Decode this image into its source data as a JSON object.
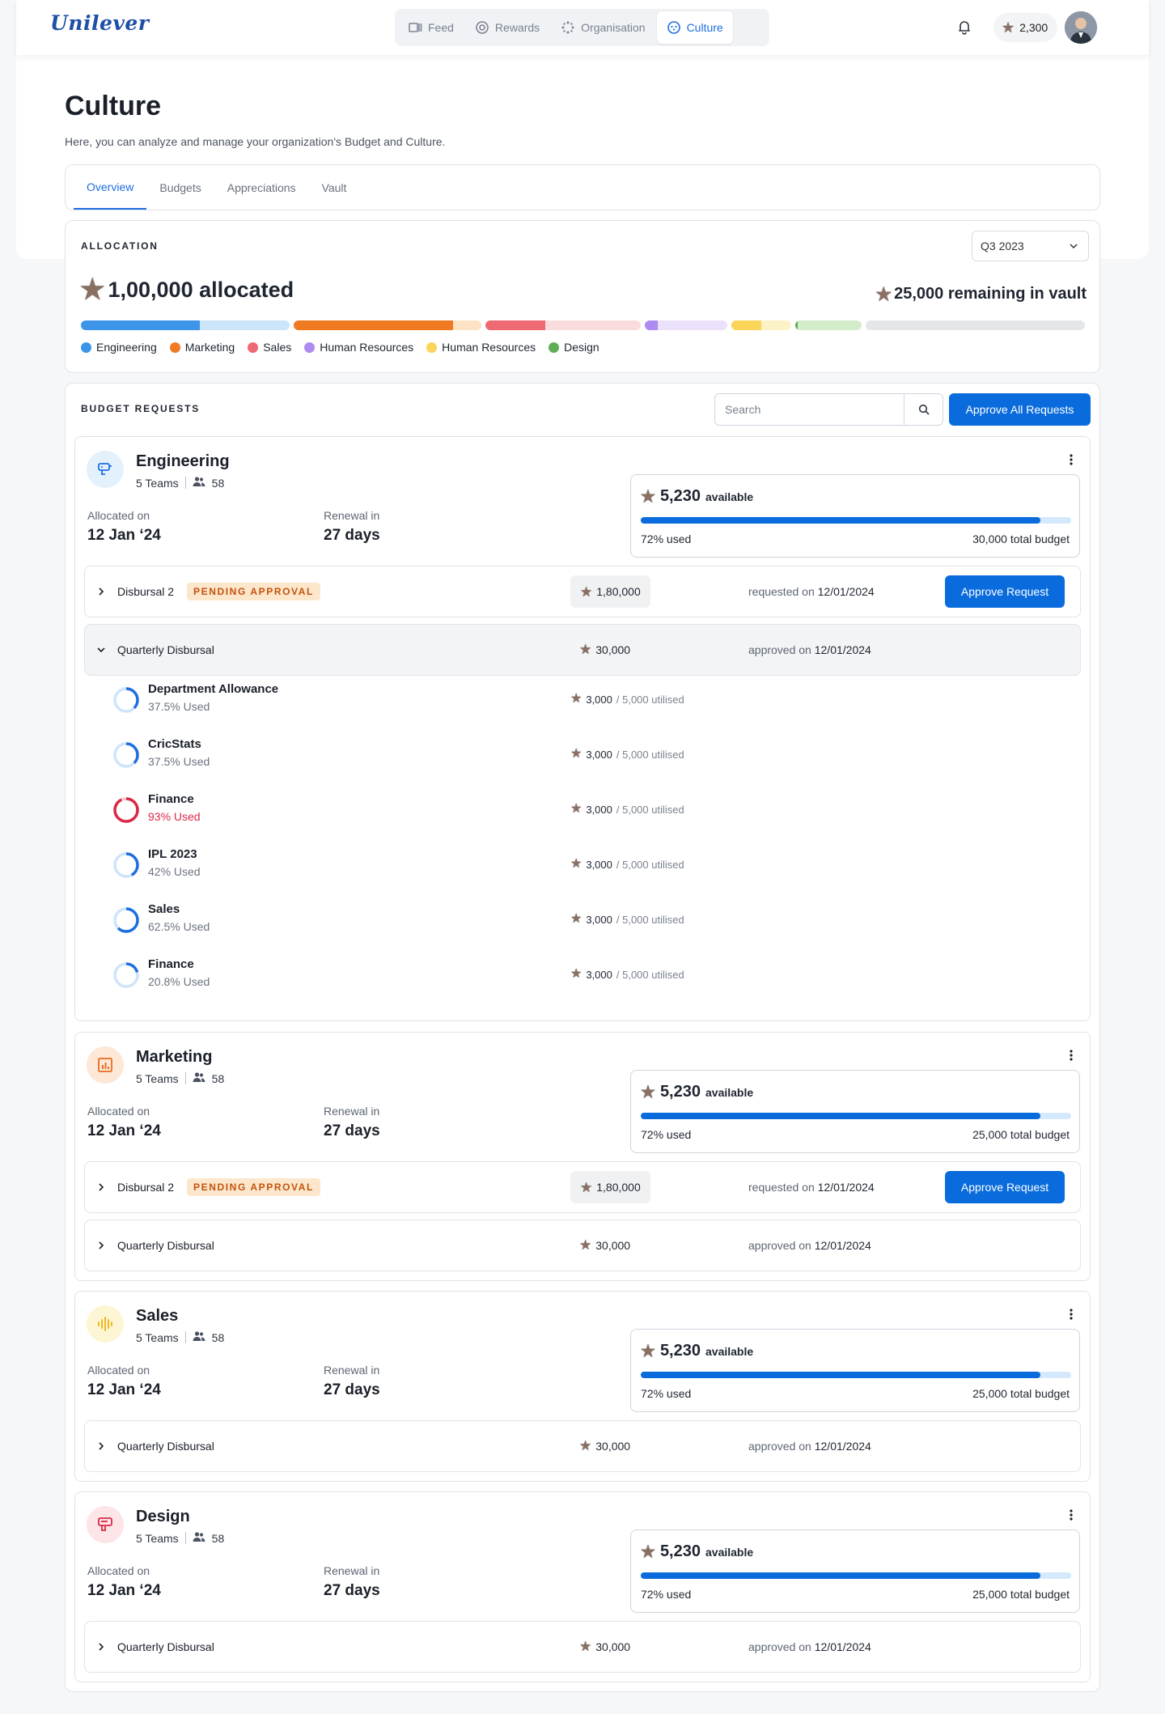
{
  "brand": {
    "logo": "Unilever"
  },
  "nav": {
    "items": [
      {
        "label": "Feed",
        "icon": "feed-icon"
      },
      {
        "label": "Rewards",
        "icon": "rewards-icon"
      },
      {
        "label": "Organisation",
        "icon": "organisation-icon"
      },
      {
        "label": "Culture",
        "icon": "culture-icon",
        "active": true
      }
    ]
  },
  "header": {
    "points": "2,300"
  },
  "page": {
    "title": "Culture",
    "subtitle": "Here, you can analyze and manage your organization's Budget and Culture."
  },
  "tabs": [
    {
      "label": "Overview",
      "active": true
    },
    {
      "label": "Budgets"
    },
    {
      "label": "Appreciations"
    },
    {
      "label": "Vault"
    }
  ],
  "allocation": {
    "label": "ALLOCATION",
    "quarter": "Q3 2023",
    "allocated": "1,00,000 allocated",
    "vault": "25,000 remaining in vault",
    "legend": [
      {
        "label": "Engineering",
        "color": "#3d95ea"
      },
      {
        "label": "Marketing",
        "color": "#ef7a22"
      },
      {
        "label": "Sales",
        "color": "#ee6a72"
      },
      {
        "label": "Human Resources",
        "color": "#ad8bf0"
      },
      {
        "label": "Human Resources",
        "color": "#fad55a"
      },
      {
        "label": "Design",
        "color": "#5fae56"
      }
    ]
  },
  "requests": {
    "label": "BUDGET REQUESTS",
    "search_placeholder": "Search",
    "approve_all": "Approve All Requests",
    "labels": {
      "allocated_on": "Allocated on",
      "renewal_in": "Renewal in",
      "available": "available",
      "used_suffix": "used",
      "total_suffix": "total budget",
      "requested_on": "requested on",
      "approved_on": "approved on",
      "approve_request": "Approve Request",
      "pending": "PENDING APPROVAL",
      "used_word": "Used",
      "utilised": "utilised"
    },
    "departments": [
      {
        "name": "Engineering",
        "teams": "5 Teams",
        "members": "58",
        "allocated_on": "12 Jan ‘24",
        "renewal": "27 days",
        "available": "5,230",
        "used_pct": "72%",
        "total": "30,000",
        "used_frac": 0.928,
        "rows": [
          {
            "name": "Disbursal 2",
            "pending": true,
            "amount": "1,80,000",
            "date_label": "requested on",
            "date": "12/01/2024"
          },
          {
            "name": "Quarterly Disbursal",
            "pending": false,
            "expanded": true,
            "amount": "30,000",
            "date_label": "approved on",
            "date": "12/01/2024",
            "items": [
              {
                "name": "Department Allowance",
                "pct": "37.5%",
                "frac": 0.375,
                "amount": "3,000",
                "of": "/ 5,000 utilised"
              },
              {
                "name": "CricStats",
                "pct": "37.5%",
                "frac": 0.375,
                "amount": "3,000",
                "of": "/ 5,000 utilised"
              },
              {
                "name": "Finance",
                "pct": "93%",
                "frac": 0.93,
                "amount": "3,000",
                "of": "/ 5,000 utilised",
                "red": true
              },
              {
                "name": "IPL 2023",
                "pct": "42%",
                "frac": 0.42,
                "amount": "3,000",
                "of": "/ 5,000 utilised"
              },
              {
                "name": "Sales",
                "pct": "62.5%",
                "frac": 0.625,
                "amount": "3,000",
                "of": "/ 5,000 utilised"
              },
              {
                "name": "Finance",
                "pct": "20.8%",
                "frac": 0.208,
                "amount": "3,000",
                "of": "/ 5,000 utilised"
              }
            ]
          }
        ]
      },
      {
        "name": "Marketing",
        "teams": "5 Teams",
        "members": "58",
        "allocated_on": "12 Jan ‘24",
        "renewal": "27 days",
        "available": "5,230",
        "used_pct": "72%",
        "total": "25,000",
        "used_frac": 0.928,
        "rows": [
          {
            "name": "Disbursal 2",
            "pending": true,
            "amount": "1,80,000",
            "date_label": "requested on",
            "date": "12/01/2024"
          },
          {
            "name": "Quarterly Disbursal",
            "pending": false,
            "amount": "30,000",
            "date_label": "approved on",
            "date": "12/01/2024"
          }
        ]
      },
      {
        "name": "Sales",
        "teams": "5 Teams",
        "members": "58",
        "allocated_on": "12 Jan ‘24",
        "renewal": "27 days",
        "available": "5,230",
        "used_pct": "72%",
        "total": "25,000",
        "used_frac": 0.928,
        "rows": [
          {
            "name": "Quarterly Disbursal",
            "pending": false,
            "amount": "30,000",
            "date_label": "approved on",
            "date": "12/01/2024"
          }
        ]
      },
      {
        "name": "Design",
        "teams": "5 Teams",
        "members": "58",
        "allocated_on": "12 Jan ‘24",
        "renewal": "27 days",
        "available": "5,230",
        "used_pct": "72%",
        "total": "25,000",
        "used_frac": 0.928,
        "rows": [
          {
            "name": "Quarterly Disbursal",
            "pending": false,
            "amount": "30,000",
            "date_label": "approved on",
            "date": "12/01/2024"
          }
        ]
      }
    ]
  }
}
